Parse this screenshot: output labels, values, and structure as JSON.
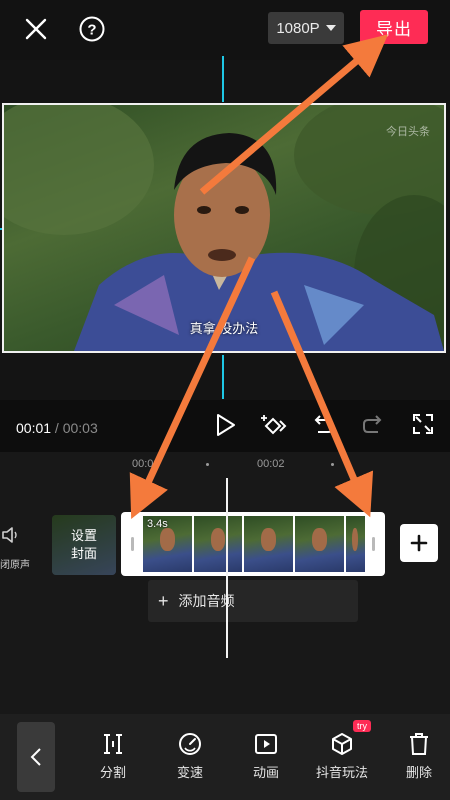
{
  "header": {
    "resolution_label": "1080P",
    "export_label": "导出"
  },
  "preview": {
    "subtitle": "真拿    没办法",
    "watermark": "今日头条"
  },
  "playback": {
    "current_time": "00:01",
    "separator": " / ",
    "total_time": "00:03"
  },
  "timeline": {
    "ruler_labels": [
      "00:00",
      "00:02"
    ],
    "cover_label_line1": "设置",
    "cover_label_line2": "封面",
    "clip_duration": "3.4s",
    "mute_label": "闭原声",
    "add_audio_label": "添加音频"
  },
  "toolbar": {
    "items": [
      {
        "label": "分割",
        "icon": "split-icon"
      },
      {
        "label": "变速",
        "icon": "speed-icon"
      },
      {
        "label": "动画",
        "icon": "animation-icon"
      },
      {
        "label": "抖音玩法",
        "icon": "cube-icon"
      },
      {
        "label": "删除",
        "icon": "trash-icon"
      }
    ],
    "badge": "try"
  },
  "colors": {
    "accent": "#fe2c55",
    "guide": "#1ec8e6",
    "arrow": "#f47a3c"
  }
}
